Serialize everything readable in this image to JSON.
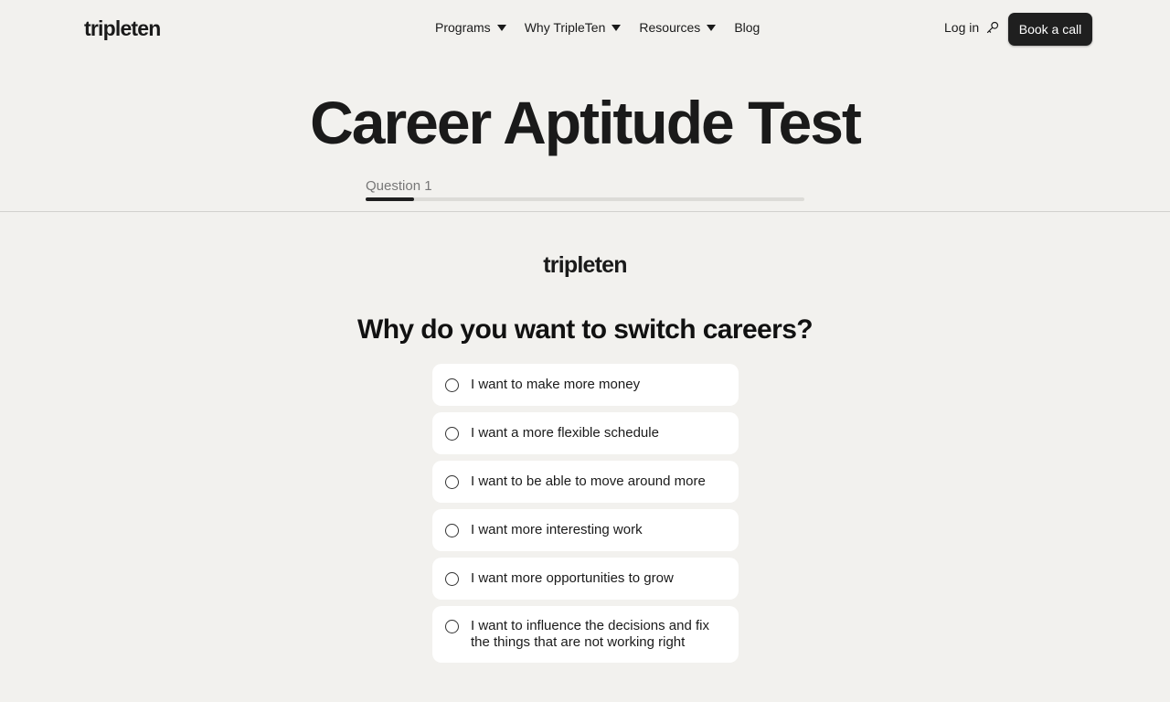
{
  "header": {
    "logo": "tripleten",
    "nav": [
      {
        "label": "Programs",
        "has_dropdown": true
      },
      {
        "label": "Why TripleTen",
        "has_dropdown": true
      },
      {
        "label": "Resources",
        "has_dropdown": true
      },
      {
        "label": "Blog",
        "has_dropdown": false
      }
    ],
    "login_label": "Log in",
    "login_icon": "key-icon",
    "cta_label": "Book a call"
  },
  "page": {
    "title": "Career Aptitude Test",
    "question_label": "Question 1",
    "progress": 0.11
  },
  "quiz": {
    "logo": "tripleten",
    "question": "Why do you want to switch careers?",
    "options": [
      "I want to make more money",
      "I want a more flexible schedule",
      "I want to be able to move around more",
      "I want more interesting work",
      "I want more opportunities to grow",
      "I want to influence the decisions and fix the things that are not working right"
    ]
  },
  "colors": {
    "background": "#f2f1ee",
    "card": "#ffffff",
    "primary": "#1f1f1f",
    "muted_text": "#777777"
  }
}
